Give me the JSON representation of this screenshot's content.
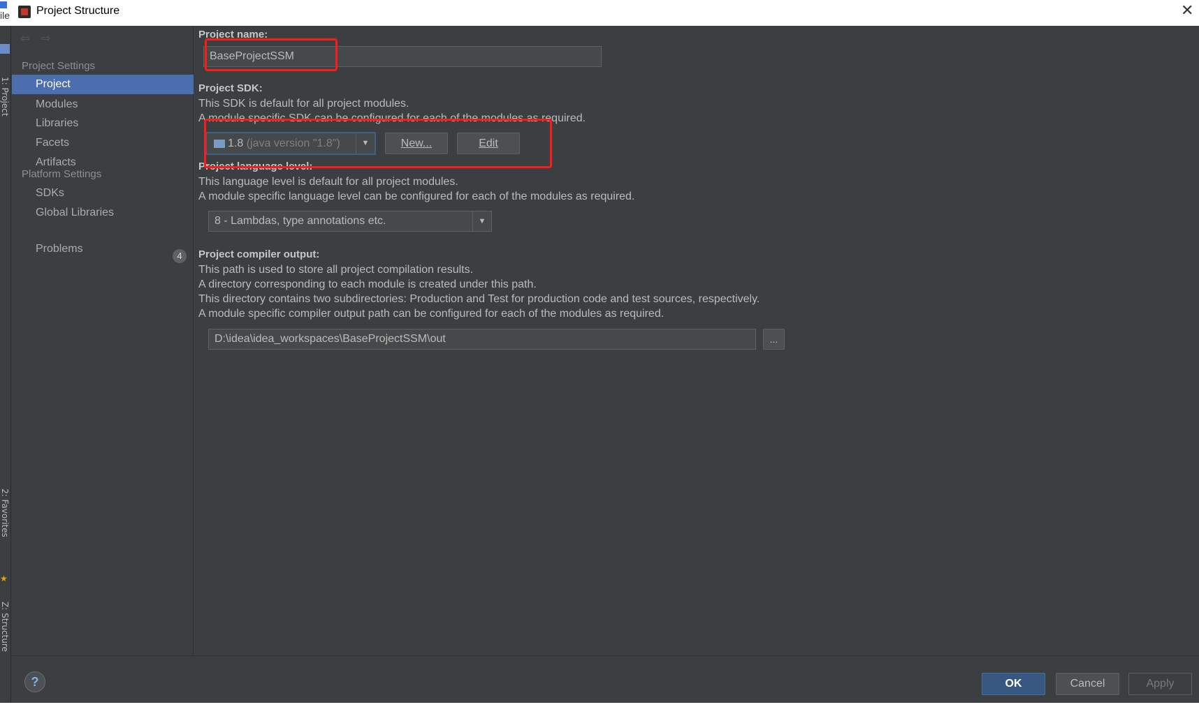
{
  "window": {
    "title": "Project Structure",
    "close_glyph": "✕"
  },
  "ide": {
    "menu_fragment": "ile",
    "side_tabs": [
      "1: Project",
      "2: Favorites",
      "Z: Structure"
    ]
  },
  "nav": {
    "back_glyph": "⇦",
    "forward_glyph": "⇨"
  },
  "sidebar": {
    "project_settings_header": "Project Settings",
    "project_items": [
      {
        "label": "Project",
        "selected": true
      },
      {
        "label": "Modules"
      },
      {
        "label": "Libraries"
      },
      {
        "label": "Facets"
      },
      {
        "label": "Artifacts"
      }
    ],
    "platform_settings_header": "Platform Settings",
    "platform_items": [
      {
        "label": "SDKs"
      },
      {
        "label": "Global Libraries"
      }
    ],
    "problems": {
      "label": "Problems",
      "count": "4"
    }
  },
  "project": {
    "name_label": "Project name:",
    "name_value": "BaseProjectSSM",
    "sdk_label": "Project SDK:",
    "sdk_desc_1": "This SDK is default for all project modules.",
    "sdk_desc_2": "A module specific SDK can be configured for each of the modules as required.",
    "sdk_value": "1.8",
    "sdk_version_hint": "(java version \"1.8\")",
    "sdk_new_button": "New...",
    "sdk_edit_button": "Edit",
    "lang_label": "Project language level:",
    "lang_desc_1": "This language level is default for all project modules.",
    "lang_desc_2": "A module specific language level can be configured for each of the modules as required.",
    "lang_value": "8 - Lambdas, type annotations etc.",
    "output_label": "Project compiler output:",
    "output_desc_1": "This path is used to store all project compilation results.",
    "output_desc_2": "A directory corresponding to each module is created under this path.",
    "output_desc_3": "This directory contains two subdirectories: Production and Test for production code and test sources, respectively.",
    "output_desc_4": "A module specific compiler output path can be configured for each of the modules as required.",
    "output_path": "D:\\idea\\idea_workspaces\\BaseProjectSSM\\out",
    "browse_button": "..."
  },
  "footer": {
    "help": "?",
    "ok": "OK",
    "cancel": "Cancel",
    "apply": "Apply"
  },
  "colors": {
    "accent": "#4b6eaf",
    "ok_button": "#365880",
    "highlight_box": "#ff1a1a",
    "background": "#3c3f41"
  }
}
